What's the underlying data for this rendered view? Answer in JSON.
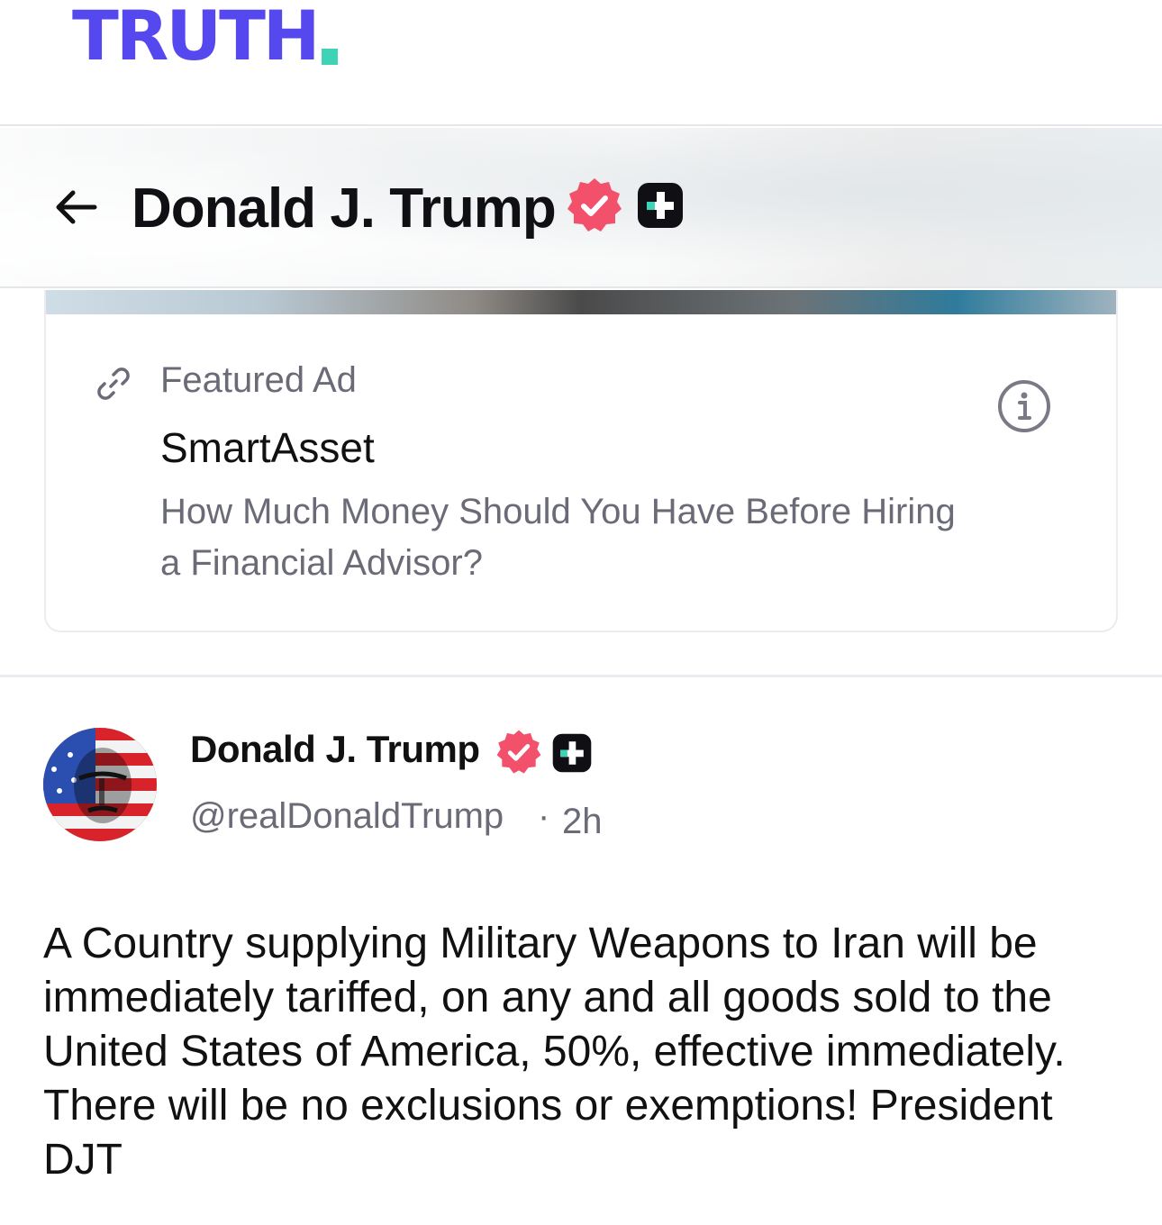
{
  "brand": {
    "logo_text": "TRUTH",
    "logo_color": "#5448ee",
    "accent_color": "#3ed3b6"
  },
  "header": {
    "back_icon": "arrow-left-icon",
    "title": "Donald J. Trump",
    "verified_icon": "verified-badge-icon",
    "verified_color": "#f2506b",
    "plus_icon": "truth-plus-icon"
  },
  "ad": {
    "link_icon": "link-icon",
    "label": "Featured Ad",
    "advertiser": "SmartAsset",
    "headline": "How Much Money Should You Have Before Hiring a Financial Advisor?",
    "info_icon": "info-icon"
  },
  "post": {
    "author_name": "Donald J. Trump",
    "handle": "@realDonaldTrump",
    "separator": "·",
    "time": "2h",
    "body": "A Country supplying Military Weapons to Iran will be immediately tariffed, on any and all goods sold to the United States of America, 50%, effective immediately. There will be no exclusions or exemptions! President DJT"
  }
}
